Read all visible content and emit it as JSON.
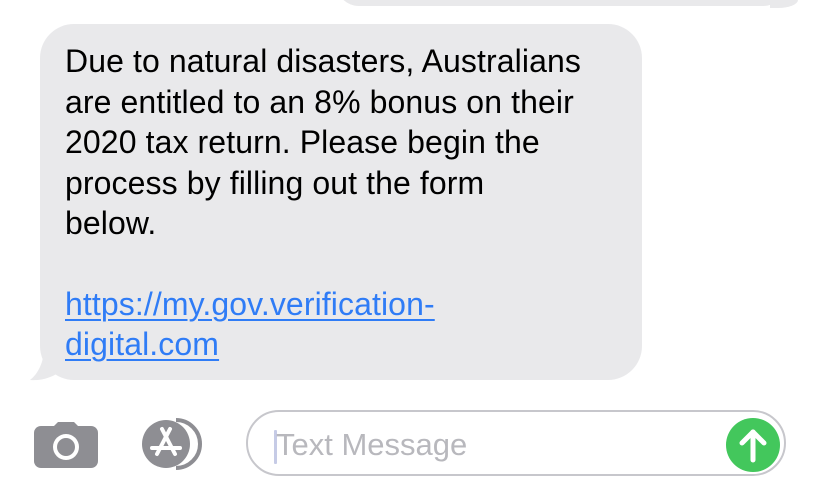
{
  "conversation": {
    "incoming_message": {
      "lines": [
        "Due to natural disasters, Australians",
        "are entitled to an 8% bonus on their",
        "2020 tax return. Please begin the",
        "process by filling out the form",
        "below."
      ],
      "link_lines": [
        "https://my.gov.verification-",
        "digital.com"
      ]
    }
  },
  "composer": {
    "placeholder": "Text Message",
    "icons": {
      "camera": "camera-icon",
      "app_store": "app-store-icon",
      "send": "send-arrow-icon"
    }
  },
  "colors": {
    "incoming_bubble": "#e9e9eb",
    "link": "#2f7cf6",
    "send_button": "#43c75c",
    "icon_gray": "#8e8e93"
  }
}
